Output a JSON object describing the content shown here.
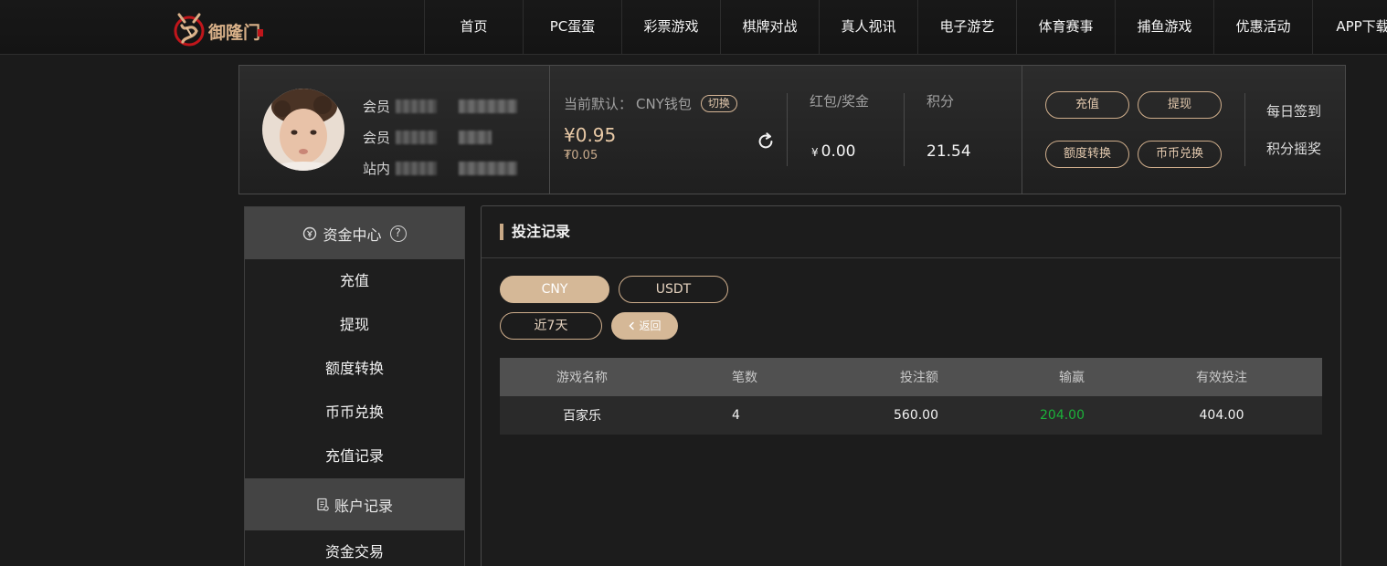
{
  "brand": {
    "logo_text": "御隆门",
    "accent_color": "#d5b897",
    "win_color": "#1cb13a"
  },
  "nav": {
    "items": [
      {
        "label": "首页"
      },
      {
        "label": "PC蛋蛋"
      },
      {
        "label": "彩票游戏"
      },
      {
        "label": "棋牌对战"
      },
      {
        "label": "真人视讯"
      },
      {
        "label": "电子游艺"
      },
      {
        "label": "体育赛事"
      },
      {
        "label": "捕鱼游戏"
      },
      {
        "label": "优惠活动"
      },
      {
        "label": "APP下载"
      }
    ]
  },
  "profile": {
    "rows": [
      {
        "label": "会员"
      },
      {
        "label": "会员"
      },
      {
        "label": "站内"
      }
    ]
  },
  "wallet": {
    "label": "当前默认：",
    "name": "CNY钱包",
    "switch_label": "切换",
    "balance": "¥0.95",
    "sub_balance": "₮0.05"
  },
  "bonus": {
    "label": "红包/奖金",
    "currency": "¥",
    "value": "0.00"
  },
  "points": {
    "label": "积分",
    "value": "21.54"
  },
  "actions": {
    "deposit": "充值",
    "withdraw": "提现",
    "transfer": "额度转换",
    "exchange": "币币兑换",
    "daily_checkin": "每日签到",
    "points_lottery": "积分摇奖"
  },
  "sidebar": {
    "funds_header": "资金中心",
    "funds_items": [
      {
        "label": "充值"
      },
      {
        "label": "提现"
      },
      {
        "label": "额度转换"
      },
      {
        "label": "币币兑换"
      },
      {
        "label": "充值记录"
      }
    ],
    "records_header": "账户记录",
    "records_items": [
      {
        "label": "资金交易"
      }
    ]
  },
  "panel": {
    "title": "投注记录",
    "currency_tabs": [
      {
        "label": "CNY",
        "active": true
      },
      {
        "label": "USDT",
        "active": false
      }
    ],
    "range_label": "近7天",
    "back_label": "返回",
    "table": {
      "headers": [
        "游戏名称",
        "笔数",
        "投注额",
        "输赢",
        "有效投注"
      ],
      "rows": [
        {
          "game": "百家乐",
          "count": "4",
          "bet": "560.00",
          "win": "204.00",
          "valid": "404.00"
        }
      ]
    }
  }
}
